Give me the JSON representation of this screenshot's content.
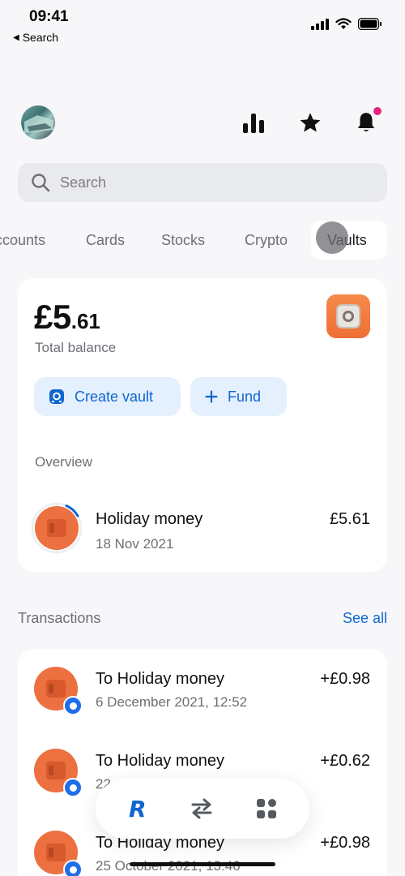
{
  "status_bar": {
    "time": "09:41",
    "back_label": "Search"
  },
  "header": {
    "icons": [
      "avatar",
      "analytics-icon",
      "star-icon",
      "bell-icon"
    ],
    "notification_dot_color": "#e2287f"
  },
  "search": {
    "placeholder": "Search"
  },
  "tabs": [
    {
      "label": "Accounts",
      "visible_label": "ccounts",
      "active": false
    },
    {
      "label": "Cards",
      "active": false
    },
    {
      "label": "Stocks",
      "active": false
    },
    {
      "label": "Crypto",
      "active": false
    },
    {
      "label": "Vaults",
      "active": true
    }
  ],
  "balance": {
    "currency_major": "£5",
    "minor": ".61",
    "label": "Total balance"
  },
  "actions": {
    "create_vault": "Create vault",
    "fund": "Fund"
  },
  "overview": {
    "label": "Overview",
    "vault": {
      "name": "Holiday money",
      "date": "18 Nov 2021",
      "amount": "£5.61"
    }
  },
  "transactions": {
    "title": "Transactions",
    "see_all": "See all",
    "items": [
      {
        "name": "To Holiday money",
        "date": "6 December 2021, 12:52",
        "amount": "+£0.98"
      },
      {
        "name": "To Holiday money",
        "date": "22",
        "amount": "+£0.62"
      },
      {
        "name": "To Holiday money",
        "date": "25 October 2021, 13:46",
        "amount": "+£0.98"
      }
    ]
  },
  "bottom_nav": {
    "items": [
      "home-icon",
      "transfer-icon",
      "hub-icon"
    ],
    "active": "home-icon"
  },
  "colors": {
    "accent": "#0f66d0",
    "vault_orange": "#ec7040",
    "background": "#f7f7f9"
  }
}
